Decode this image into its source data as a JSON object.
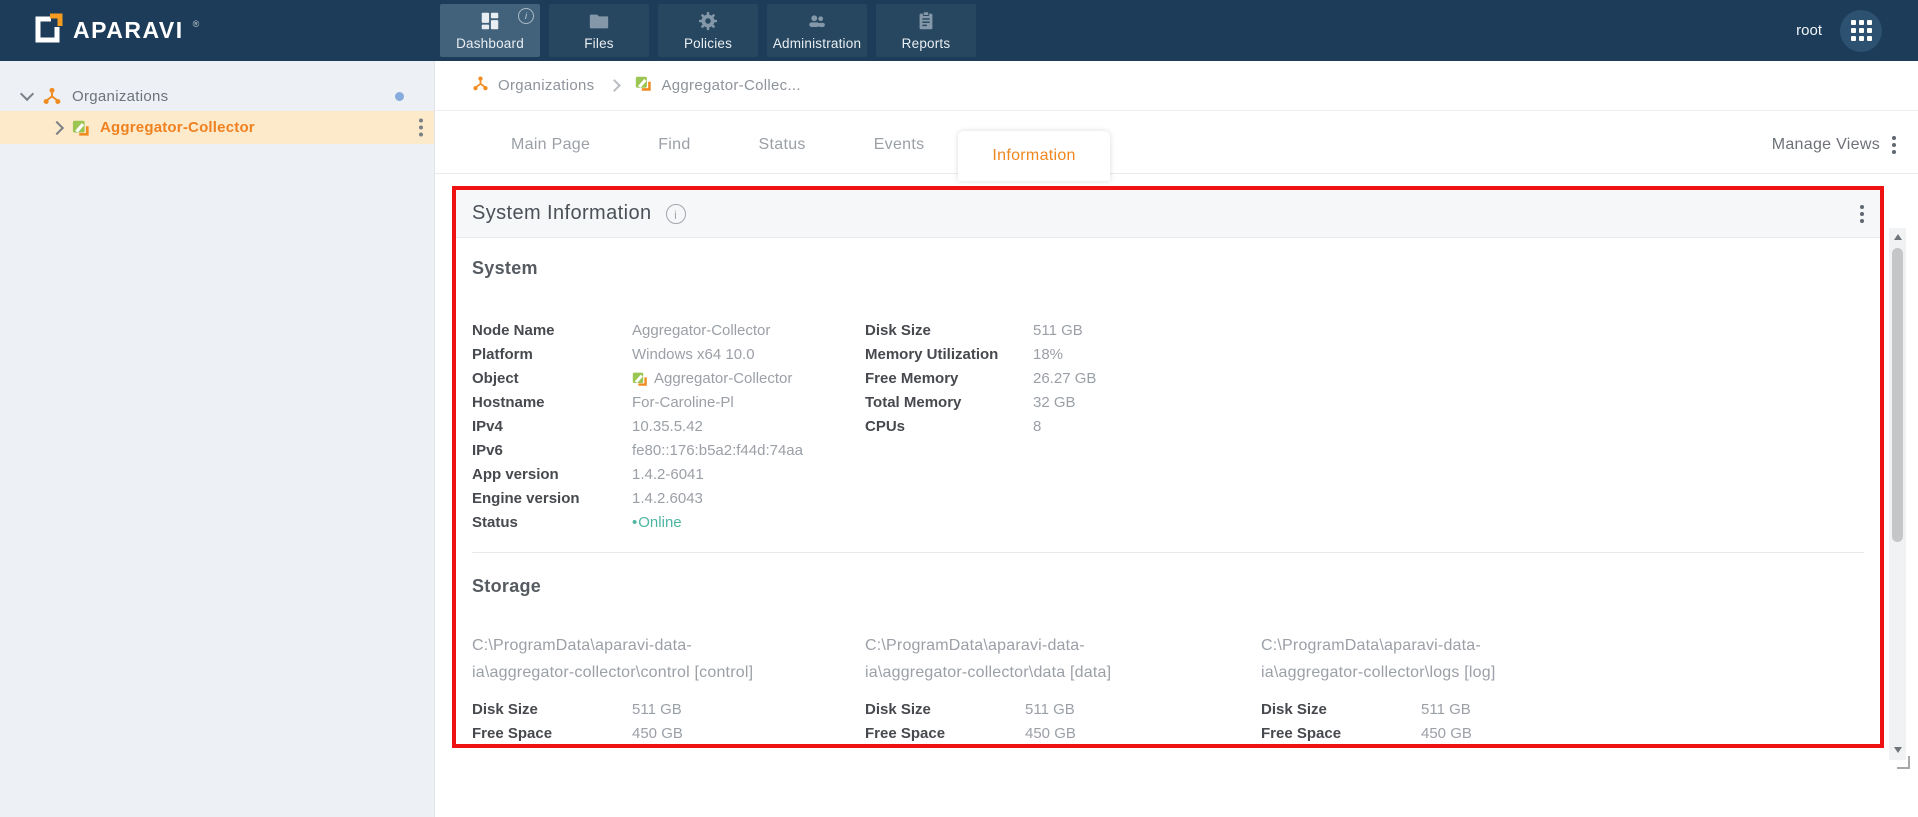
{
  "app": {
    "brand": "APARAVI",
    "trademark": "®",
    "user": "root"
  },
  "nav": {
    "items": [
      {
        "label": "Dashboard",
        "icon": "dashboard-icon",
        "active": true,
        "badge": "i"
      },
      {
        "label": "Files",
        "icon": "folder-icon",
        "active": false
      },
      {
        "label": "Policies",
        "icon": "gear-icon",
        "active": false
      },
      {
        "label": "Administration",
        "icon": "people-icon",
        "active": false
      },
      {
        "label": "Reports",
        "icon": "clipboard-icon",
        "active": false
      }
    ]
  },
  "sidebar": {
    "items": [
      {
        "label": "Organizations",
        "icon": "organizations-icon",
        "expanded": true,
        "has_notification_dot": true
      },
      {
        "label": "Aggregator-Collector",
        "icon": "collector-icon",
        "selected": true
      }
    ]
  },
  "breadcrumb": {
    "items": [
      {
        "label": "Organizations",
        "icon": "organizations-icon"
      },
      {
        "label": "Aggregator-Collec...",
        "icon": "collector-icon"
      }
    ]
  },
  "tabs": {
    "items": [
      "Main Page",
      "Find",
      "Status",
      "Events",
      "Information"
    ],
    "active": "Information",
    "manage_views": "Manage Views"
  },
  "panel": {
    "title": "System Information",
    "info_glyph": "i",
    "system": {
      "heading": "System",
      "left": [
        {
          "label": "Node Name",
          "value": "Aggregator-Collector"
        },
        {
          "label": "Platform",
          "value": "Windows x64 10.0"
        },
        {
          "label": "Object",
          "value": "Aggregator-Collector",
          "icon": "collector-icon"
        },
        {
          "label": "Hostname",
          "value": "For-Caroline-Pl"
        },
        {
          "label": "IPv4",
          "value": "10.35.5.42"
        },
        {
          "label": "IPv6",
          "value": "fe80::176:b5a2:f44d:74aa"
        },
        {
          "label": "App version",
          "value": "1.4.2-6041"
        },
        {
          "label": "Engine version",
          "value": "1.4.2.6043"
        },
        {
          "label": "Status",
          "value": "Online",
          "bullet": "•"
        }
      ],
      "right": [
        {
          "label": "Disk Size",
          "value": "511 GB"
        },
        {
          "label": "Memory Utilization",
          "value": "18%"
        },
        {
          "label": "Free Memory",
          "value": "26.27 GB"
        },
        {
          "label": "Total Memory",
          "value": "32 GB"
        },
        {
          "label": "CPUs",
          "value": "8"
        }
      ]
    },
    "storage": {
      "heading": "Storage",
      "labels": {
        "disk_size": "Disk Size",
        "free_space": "Free Space"
      },
      "volumes": [
        {
          "path_lines": [
            "C:\\ProgramData\\aparavi-data-",
            "ia\\aggregator-collector\\control [control]"
          ],
          "disk_size": "511 GB",
          "free_space": "450 GB"
        },
        {
          "path_lines": [
            "C:\\ProgramData\\aparavi-data-",
            "ia\\aggregator-collector\\data [data]"
          ],
          "disk_size": "511 GB",
          "free_space": "450 GB"
        },
        {
          "path_lines": [
            "C:\\ProgramData\\aparavi-data-",
            "ia\\aggregator-collector\\logs [log]"
          ],
          "disk_size": "511 GB",
          "free_space": "450 GB"
        }
      ]
    }
  },
  "colors": {
    "header_navy": "#1c3c59",
    "nav_button": "#26475f",
    "nav_button_active": "#42627b",
    "accent_orange": "#f0861f",
    "selected_row_bg": "#fdeacb",
    "online_teal": "#4db6a2",
    "annotation_red": "#ee1212",
    "notification_dot_blue": "#86abdd"
  }
}
